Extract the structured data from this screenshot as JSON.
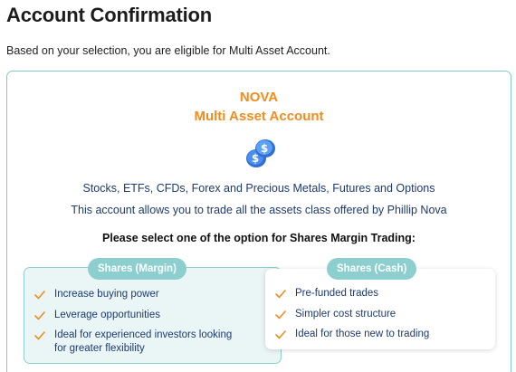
{
  "page": {
    "title": "Account Confirmation",
    "intro": "Based on your selection, you are eligible for Multi Asset Account."
  },
  "card": {
    "brand": "NOVA",
    "account_name": "Multi Asset Account",
    "icon": "dollar-coins-icon",
    "assets": "Stocks, ETFs, CFDs, Forex and Precious Metals, Futures and Options",
    "description": "This account allows you to trade all the assets class offered by Phillip Nova",
    "prompt": "Please select one of the option for Shares Margin Trading:"
  },
  "options": {
    "margin": {
      "label": "Shares (Margin)",
      "features": [
        "Increase buying power",
        "Leverage opportunities",
        "Ideal for experienced investors looking for greater flexibility"
      ]
    },
    "cash": {
      "label": "Shares (Cash)",
      "features": [
        "Pre-funded trades",
        "Simpler cost structure",
        "Ideal for those new to trading"
      ]
    }
  },
  "colors": {
    "accent_orange": "#f28c1c",
    "teal": "#8ccfce",
    "navy_text": "#1e3a6e",
    "selected_bg": "#eaf6f6"
  }
}
